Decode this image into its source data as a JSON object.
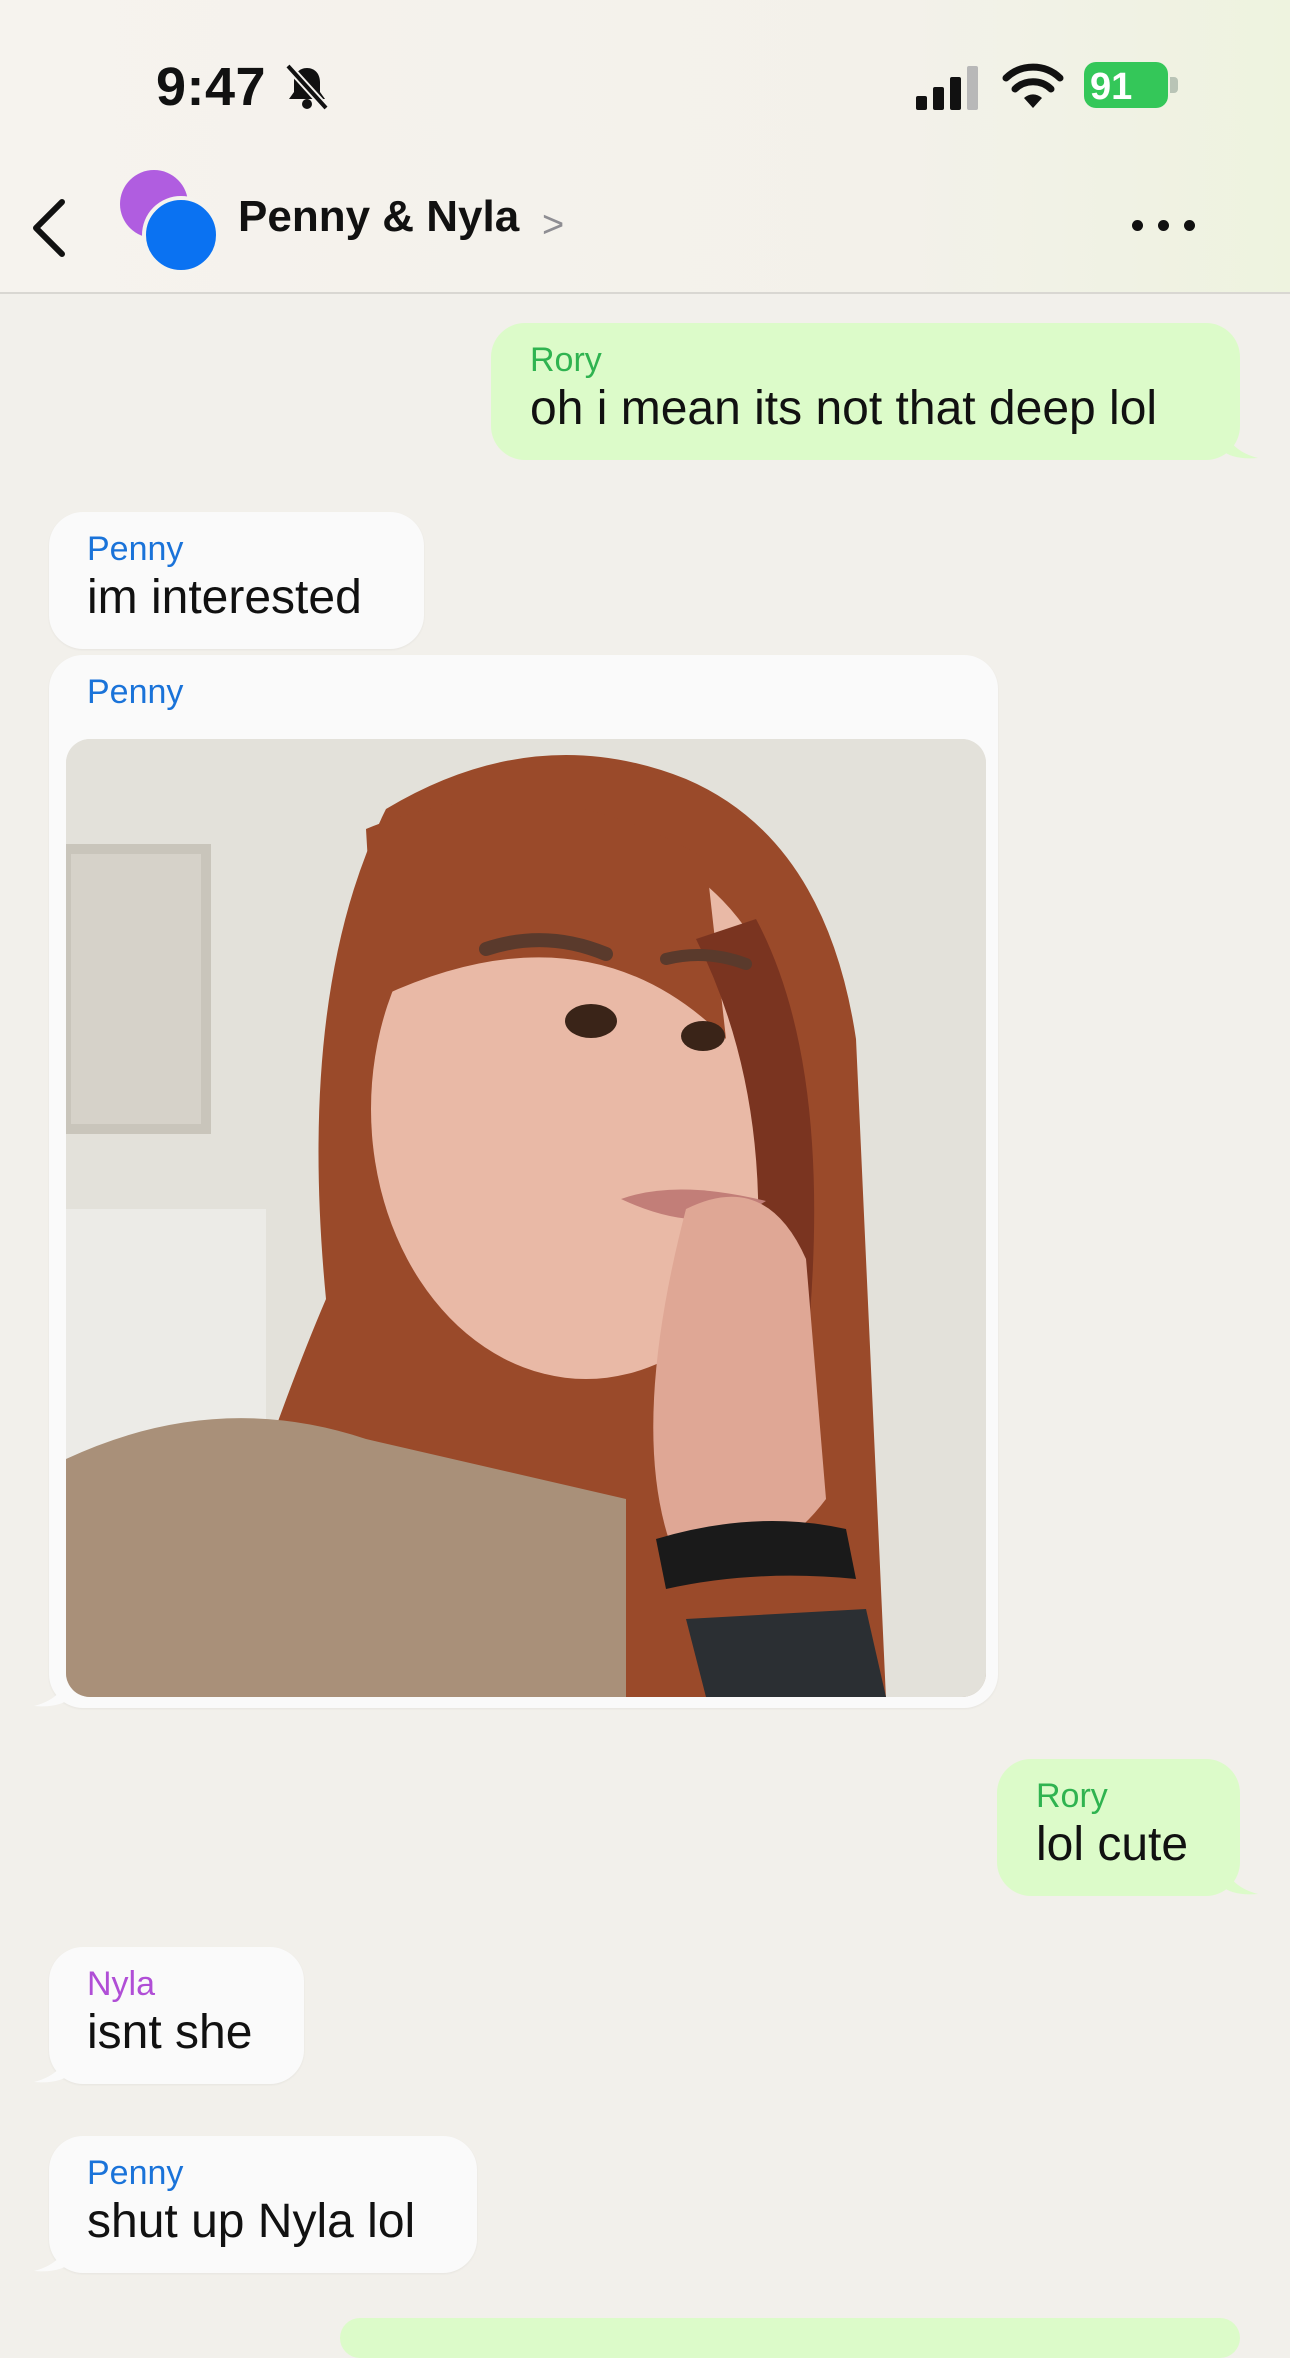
{
  "status_bar": {
    "time": "9:47",
    "battery": "91",
    "icons": [
      "bell-slash-icon",
      "cellular-signal-icon",
      "wifi-icon",
      "battery-charging-icon"
    ],
    "battery_color": "#34c759"
  },
  "header": {
    "title": "Penny & Nyla",
    "back_icon": "chevron-left-icon",
    "title_chevron": ">",
    "more_icon": "ellipsis-icon",
    "avatar_colors": [
      "#b05de0",
      "#0a72f2"
    ]
  },
  "messages": [
    {
      "sender": "Rory",
      "text": "oh i mean its not that deep lol",
      "direction": "outgoing"
    },
    {
      "sender": "Penny",
      "text": "im interested",
      "direction": "incoming"
    },
    {
      "sender": "Penny",
      "type": "image",
      "image": "selfie photo",
      "direction": "incoming"
    },
    {
      "sender": "Rory",
      "text": "lol cute",
      "direction": "outgoing"
    },
    {
      "sender": "Nyla",
      "text": "isnt she",
      "direction": "incoming"
    },
    {
      "sender": "Penny",
      "text": "shut up Nyla lol",
      "direction": "incoming"
    }
  ],
  "colors": {
    "outgoing_bubble": "#dcfbc9",
    "incoming_bubble": "#fafafa",
    "rory": "#2fb350",
    "penny": "#1a73d9",
    "nyla": "#b04ed6",
    "background": "#f2f0eb"
  }
}
